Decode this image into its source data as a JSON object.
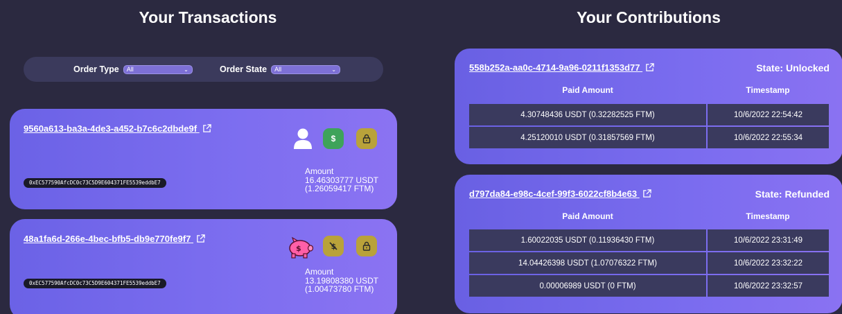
{
  "transactions": {
    "title": "Your Transactions",
    "filters": {
      "order_type_label": "Order Type",
      "order_type_value": "All",
      "order_state_label": "Order State",
      "order_state_value": "All"
    },
    "cards": [
      {
        "id": "9560a613-ba3a-4de3-a452-b7c6c2dbde9f",
        "address": "0xEC577590AfcDC0c73C5D9E604371FE5539eddbE7",
        "amount_label": "Amount",
        "amount_usdt": "16.46303777 USDT",
        "amount_ftm": "(1.26059417 FTM)",
        "buttons": [
          {
            "icon": "dollar-icon",
            "glyph": "$",
            "color": "#3ea35a"
          },
          {
            "icon": "lock-icon",
            "color": "#b9a23a"
          }
        ]
      },
      {
        "id": "48a1fa6d-266e-4bec-bfb5-db9e770fe9f7",
        "address": "0xEC577590AfcDC0c73C5D9E604371FE5539eddbE7",
        "amount_label": "Amount",
        "amount_usdt": "13.19808380 USDT",
        "amount_ftm": "(1.00473780 FTM)",
        "buttons": [
          {
            "icon": "no-dollar-icon",
            "glyph": "$",
            "color": "#b9a23a"
          },
          {
            "icon": "lock-icon",
            "color": "#b9a23a"
          }
        ]
      }
    ]
  },
  "contributions": {
    "title": "Your Contributions",
    "headers": {
      "paid": "Paid Amount",
      "time": "Timestamp"
    },
    "cards": [
      {
        "id": "558b252a-aa0c-4714-9a96-0211f1353d77",
        "state": "State: Unlocked",
        "rows": [
          {
            "paid": "4.30748436 USDT  (0.32282525 FTM)",
            "time": "10/6/2022 22:54:42"
          },
          {
            "paid": "4.25120010 USDT  (0.31857569 FTM)",
            "time": "10/6/2022 22:55:34"
          }
        ]
      },
      {
        "id": "d797da84-e98c-4cef-99f3-6022cf8b4e63",
        "state": "State: Refunded",
        "rows": [
          {
            "paid": "1.60022035 USDT  (0.11936430 FTM)",
            "time": "10/6/2022 23:31:49"
          },
          {
            "paid": "14.04426398 USDT  (1.07076322 FTM)",
            "time": "10/6/2022 23:32:22"
          },
          {
            "paid": "0.00006989 USDT  (0 FTM)",
            "time": "10/6/2022 23:32:57"
          }
        ]
      }
    ]
  }
}
